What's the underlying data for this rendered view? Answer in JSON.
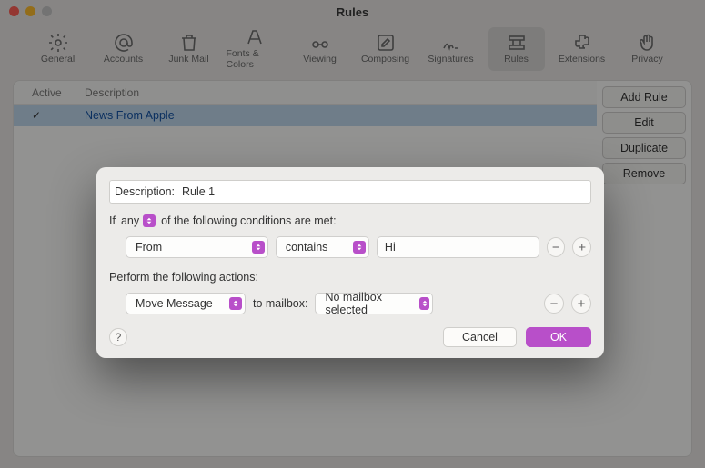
{
  "window": {
    "title": "Rules"
  },
  "toolbar": {
    "items": [
      {
        "label": "General"
      },
      {
        "label": "Accounts"
      },
      {
        "label": "Junk Mail"
      },
      {
        "label": "Fonts & Colors"
      },
      {
        "label": "Viewing"
      },
      {
        "label": "Composing"
      },
      {
        "label": "Signatures"
      },
      {
        "label": "Rules"
      },
      {
        "label": "Extensions"
      },
      {
        "label": "Privacy"
      }
    ]
  },
  "rules_table": {
    "cols": {
      "active": "Active",
      "description": "Description"
    },
    "rows": [
      {
        "active": "✓",
        "description": "News From Apple"
      }
    ]
  },
  "side_buttons": {
    "add": "Add Rule",
    "edit": "Edit",
    "duplicate": "Duplicate",
    "remove": "Remove"
  },
  "sheet": {
    "description_label": "Description:",
    "description_value": "Rule 1",
    "if_prefix": "If",
    "any_label": "any",
    "if_suffix": "of the following conditions are met:",
    "condition": {
      "field": "From",
      "operator": "contains",
      "value": "Hi"
    },
    "minus": "−",
    "plus": "+",
    "actions_label": "Perform the following actions:",
    "action": {
      "verb": "Move Message",
      "to_mailbox_label": "to mailbox:",
      "mailbox": "No mailbox selected"
    },
    "help": "?",
    "cancel": "Cancel",
    "ok": "OK"
  }
}
